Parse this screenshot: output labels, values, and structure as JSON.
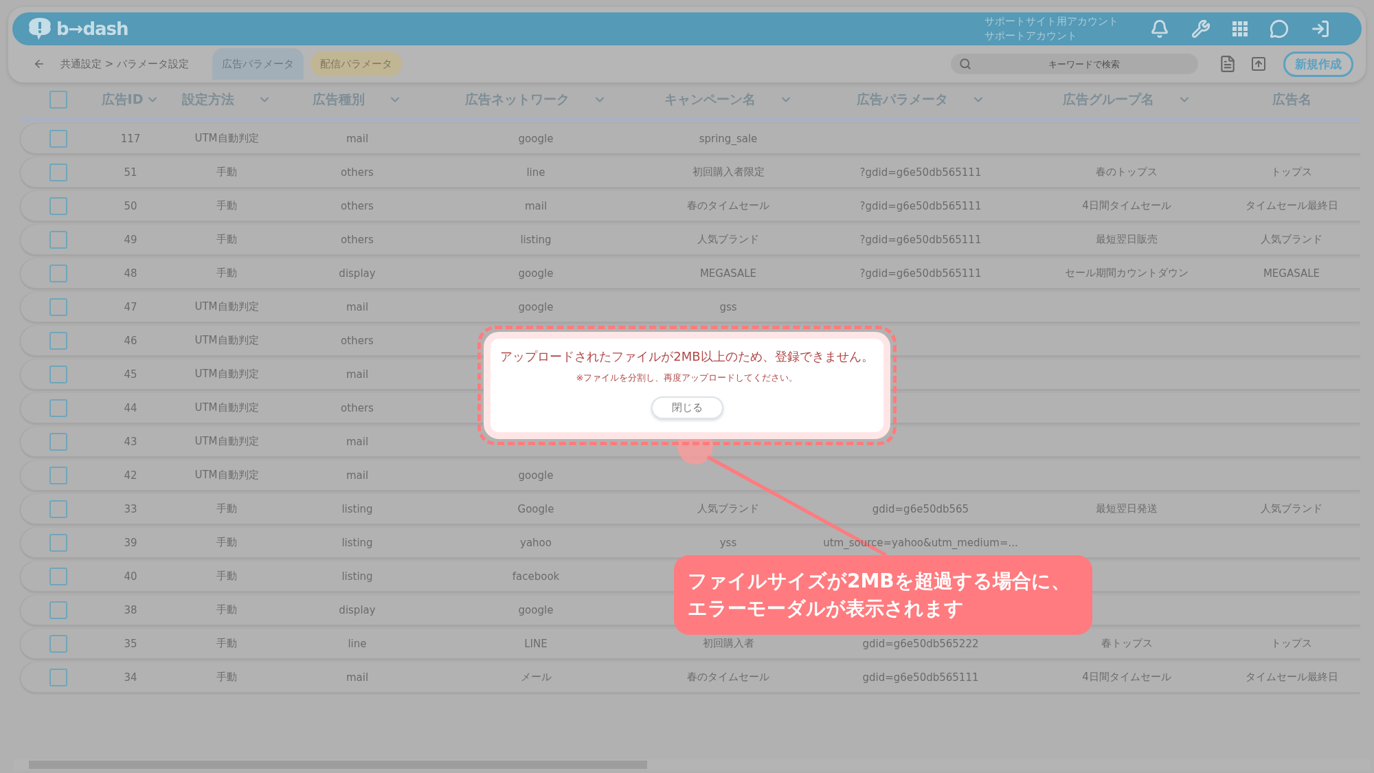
{
  "app_header": {
    "logo": "b→dash",
    "account_lines": [
      "サポートサイト用アカウント",
      "サポートアカウント"
    ]
  },
  "nav": {
    "breadcrumb": "共通設定 > パラメータ設定",
    "tabs": [
      {
        "label": "広告パラメータ",
        "selected": true
      },
      {
        "label": "配信パラメータ",
        "selected": false
      }
    ],
    "search": {
      "placeholder": "キーワードで検索"
    },
    "new_button": "新規作成"
  },
  "table": {
    "select_all": {
      "checked": false
    },
    "columns": [
      "広告ID",
      "設定方法",
      "広告種別",
      "広告ネットワーク",
      "キャンペーン名",
      "広告パラメータ",
      "広告グループ名",
      "広告名"
    ],
    "rows": [
      {
        "checked": false,
        "id": "117",
        "method": "UTM自動判定",
        "type": "mail",
        "network": "google",
        "campaign": "spring_sale"
      },
      {
        "checked": false,
        "id": "51",
        "method": "手動",
        "type": "others",
        "network": "line",
        "campaign": "初回購入者限定",
        "param": "?gdid=g6e50db565111",
        "group": "春のトップス",
        "name": "トップス"
      },
      {
        "checked": false,
        "id": "50",
        "method": "手動",
        "type": "others",
        "network": "mail",
        "campaign": "春のタイムセール",
        "param": "?gdid=g6e50db565111",
        "group": "4日間タイムセール",
        "name": "タイムセール最終日"
      },
      {
        "checked": false,
        "id": "49",
        "method": "手動",
        "type": "others",
        "network": "listing",
        "campaign": "人気ブランド",
        "param": "?gdid=g6e50db565111",
        "group": "最短翌日販売",
        "name": "人気ブランド"
      },
      {
        "checked": false,
        "id": "48",
        "method": "手動",
        "type": "display",
        "network": "google",
        "campaign": "MEGASALE",
        "param": "?gdid=g6e50db565111",
        "group": "セール期間カウントダウン",
        "name": "MEGASALE"
      },
      {
        "checked": false,
        "id": "47",
        "method": "UTM自動判定",
        "type": "mail",
        "network": "google",
        "campaign": "gss"
      },
      {
        "checked": false,
        "id": "46",
        "method": "UTM自動判定",
        "type": "others"
      },
      {
        "checked": false,
        "id": "45",
        "method": "UTM自動判定",
        "type": "mail"
      },
      {
        "checked": false,
        "id": "44",
        "method": "UTM自動判定",
        "type": "others"
      },
      {
        "checked": false,
        "id": "43",
        "method": "UTM自動判定",
        "type": "mail"
      },
      {
        "checked": false,
        "id": "42",
        "method": "UTM自動判定",
        "type": "mail",
        "network": "google"
      },
      {
        "checked": false,
        "id": "33",
        "method": "手動",
        "type": "listing",
        "network": "Google",
        "campaign": "人気ブランド",
        "param": "gdid=g6e50db565",
        "group": "最短翌日発送",
        "name": "人気ブランド"
      },
      {
        "checked": false,
        "id": "39",
        "method": "手動",
        "type": "listing",
        "network": "yahoo",
        "campaign": "yss",
        "param": "utm_source=yahoo&utm_medium=..."
      },
      {
        "checked": false,
        "id": "40",
        "method": "手動",
        "type": "listing",
        "network": "facebook"
      },
      {
        "checked": false,
        "id": "38",
        "method": "手動",
        "type": "display",
        "network": "google"
      },
      {
        "checked": false,
        "id": "35",
        "method": "手動",
        "type": "line",
        "network": "LINE",
        "campaign": "初回購入者",
        "param": "gdid=g6e50db565222",
        "group": "春トップス",
        "name": "トップス"
      },
      {
        "checked": false,
        "id": "34",
        "method": "手動",
        "type": "mail",
        "network": "メール",
        "campaign": "春のタイムセール",
        "param": "gdid=g6e50db565111",
        "group": "4日間タイムセール",
        "name": "タイムセール最終日"
      }
    ]
  },
  "error_modal": {
    "message": "アップロードされたファイルが2MB以上のため、登録できません。",
    "note": "※ファイルを分割し、再度アップロードしてください。",
    "close_button": "閉じる"
  },
  "callout": {
    "lines": [
      "ファイルサイズが2MBを超過する場合に、",
      "エラーモーダルが表示されます"
    ]
  }
}
